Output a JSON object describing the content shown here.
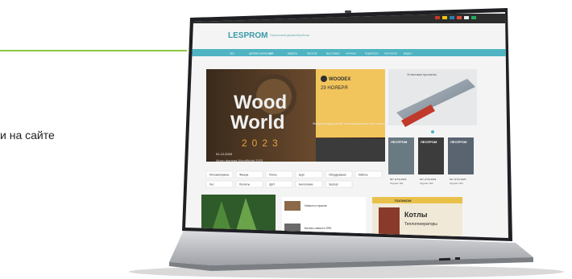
{
  "side_caption": "и на сайте",
  "colors": {
    "accent": "#8cc63f",
    "nav": "#4fb3c2",
    "hero_orange": "#e9a13b",
    "woodex_bg": "#f2c55c"
  },
  "site": {
    "logo": "LESPROM",
    "logo_sub": "Отраслевой деревообработки",
    "nav_items": [
      "ЛЕС",
      "ДЕРЕВООБРАБОТКА",
      "ЦБП",
      "МЕБЕЛЬ",
      "ЛЕСНОЕ",
      "ВЫСТАВКИ",
      "ЖУРНАЛ",
      "ПОДПИСКА",
      "КОНТАКТЫ",
      "ВИДЕО"
    ],
    "hero": {
      "title_line1": "Wood",
      "title_line2": "World",
      "year": "2023",
      "caption": "Итоги форума WoodWorld 2023",
      "date_text": "01.12.2023"
    },
    "woodex": {
      "brand": "WOODEX",
      "date": "29 НОЯБРЯ",
      "desc": "Форум предприятий лесопромышленного комплекса"
    },
    "sub_labels": [
      "Пиломатериалы",
      "Фанера",
      "Плиты",
      "Брус",
      "Оборудование",
      "Мебель",
      "Лес",
      "Пеллеты",
      "ЦБП",
      "Биотопливо",
      "Экспорт"
    ],
    "right_banner": "Установки пропитки",
    "magazines": [
      {
        "title": "ЛЕСПРОМ",
        "date": "№7 (174) 2023",
        "label": "Журнал №1"
      },
      {
        "title": "ЛЕСПРОМ",
        "date": "№7 (173) 2023",
        "label": "Журнал №2"
      },
      {
        "title": "ЛЕСПРОМ",
        "date": "№7 (172) 2023",
        "label": "Журнал №3"
      }
    ],
    "news_a": "Новости отрасли",
    "news_b": "Бизнес-новости ЛПК",
    "boiler_ad": {
      "brand": "ПОЛИКОМ",
      "title": "Котлы",
      "sub": "Теплогенераторы"
    }
  }
}
